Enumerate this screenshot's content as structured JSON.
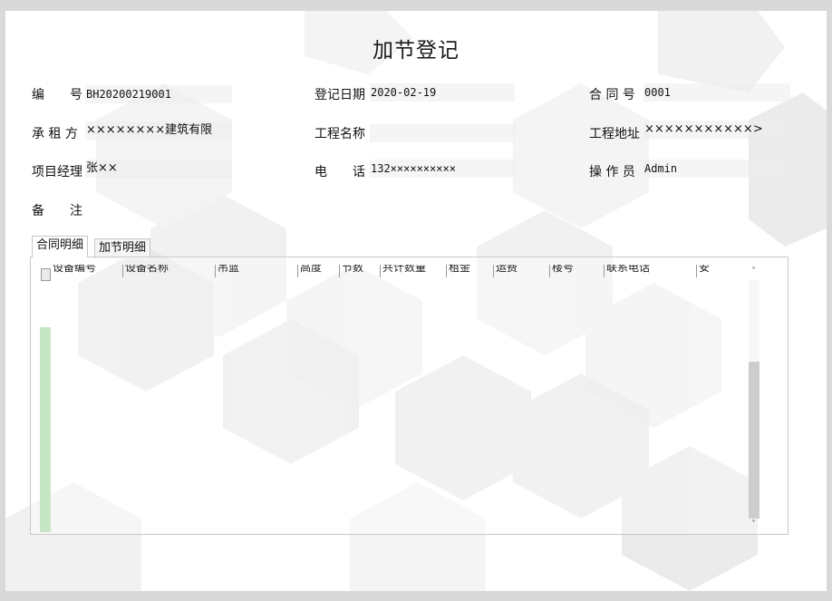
{
  "form": {
    "title": "加节登记",
    "fields": {
      "number": {
        "label": "编　　号",
        "value": "BH20200219001"
      },
      "reg_date": {
        "label": "登记日期",
        "value": "2020-02-19"
      },
      "contract_no": {
        "label": "合 同 号",
        "value": "0001"
      },
      "renter": {
        "label": "承 租 方",
        "value": "××××××××建筑有限"
      },
      "project_name": {
        "label": "工程名称",
        "value": ""
      },
      "project_address": {
        "label": "工程地址",
        "value": "×××××××××××>"
      },
      "manager": {
        "label": "项目经理",
        "value": "张××"
      },
      "phone": {
        "label": "电　　话",
        "value": "132××××××××××"
      },
      "operator": {
        "label": "操 作 员",
        "value": "Admin"
      },
      "remark": {
        "label": "备　　注",
        "value": ""
      }
    }
  },
  "tabs": [
    {
      "label": "合同明细",
      "active": true
    },
    {
      "label": "加节明细",
      "active": false
    }
  ],
  "grid": {
    "columns": [
      "设备编号",
      "设备名称",
      "吊篮",
      "高度",
      "节数",
      "共计数量",
      "租金",
      "运费",
      "楼号",
      "联系电话",
      "安"
    ]
  },
  "scrollbar": {
    "up_icon": "chevron-up-icon",
    "down_icon": "chevron-down-icon",
    "up_glyph": "˄",
    "down_glyph": "˅"
  },
  "colors": {
    "window_bg": "#ffffff",
    "frame": "#d9d9d9",
    "row_indicator": "#c6e6c6",
    "scroll_thumb": "#cdcdcd"
  }
}
